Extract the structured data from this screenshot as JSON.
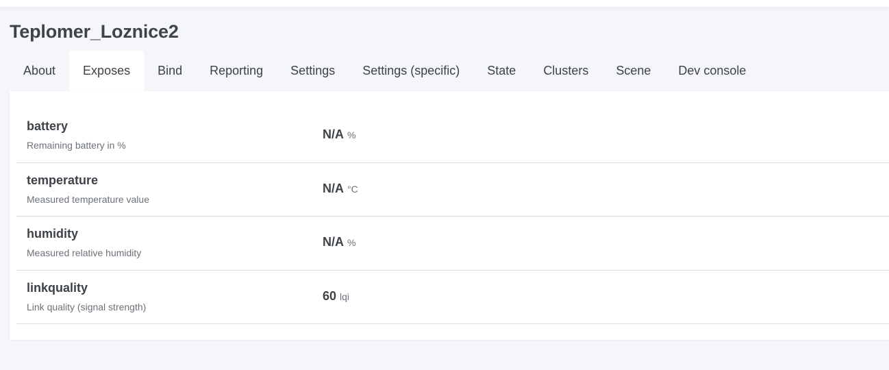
{
  "device": {
    "title": "Teplomer_Loznice2"
  },
  "tabs": [
    {
      "label": "About",
      "active": false
    },
    {
      "label": "Exposes",
      "active": true
    },
    {
      "label": "Bind",
      "active": false
    },
    {
      "label": "Reporting",
      "active": false
    },
    {
      "label": "Settings",
      "active": false
    },
    {
      "label": "Settings (specific)",
      "active": false
    },
    {
      "label": "State",
      "active": false
    },
    {
      "label": "Clusters",
      "active": false
    },
    {
      "label": "Scene",
      "active": false
    },
    {
      "label": "Dev console",
      "active": false
    }
  ],
  "exposes": [
    {
      "name": "battery",
      "description": "Remaining battery in %",
      "value": "N/A",
      "unit": "%"
    },
    {
      "name": "temperature",
      "description": "Measured temperature value",
      "value": "N/A",
      "unit": "°C"
    },
    {
      "name": "humidity",
      "description": "Measured relative humidity",
      "value": "N/A",
      "unit": "%"
    },
    {
      "name": "linkquality",
      "description": "Link quality (signal strength)",
      "value": "60",
      "unit": "lqi"
    }
  ],
  "colors": {
    "page_background": "#f5f6fa",
    "card_background": "#ffffff",
    "text": "#3d4248",
    "muted_text": "#6b7178",
    "divider": "#dcdee2"
  }
}
